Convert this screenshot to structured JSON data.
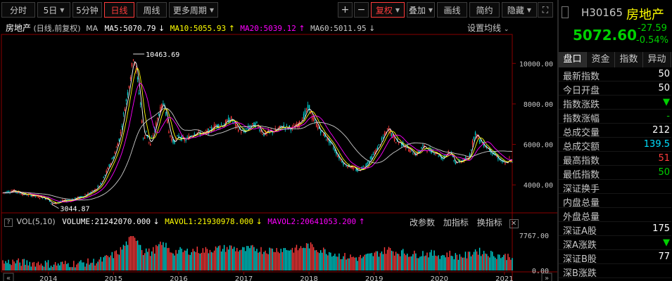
{
  "toolbar": {
    "left": [
      {
        "label": "分时",
        "dropdown": false,
        "active": false
      },
      {
        "label": "5日",
        "dropdown": true,
        "active": false
      },
      {
        "label": "5分钟",
        "dropdown": false,
        "active": false
      },
      {
        "label": "日线",
        "dropdown": false,
        "active": true
      },
      {
        "label": "周线",
        "dropdown": false,
        "active": false
      },
      {
        "label": "更多周期",
        "dropdown": true,
        "active": false
      }
    ],
    "zoom_in": "+",
    "zoom_out": "−",
    "right": [
      {
        "label": "复权",
        "dropdown": true,
        "active": true
      },
      {
        "label": "叠加",
        "dropdown": true,
        "active": false
      },
      {
        "label": "画线",
        "dropdown": false,
        "active": false
      },
      {
        "label": "简约",
        "dropdown": false,
        "active": false
      },
      {
        "label": "隐藏",
        "dropdown": true,
        "active": false
      }
    ],
    "window_icon": "⛶"
  },
  "chart_header": {
    "title": "房地产",
    "subtitle": "(日线,前复权)",
    "indicator": "MA",
    "ma5": "MA5:5070.79",
    "ma10": "MA10:5055.93",
    "ma20": "MA20:5039.12",
    "ma60": "MA60:5011.95",
    "settings": "设置均线"
  },
  "vol_header": {
    "title": "VOL(5,10)",
    "volume": "VOLUME:21242070.000",
    "mavol1": "MAVOL1:21930978.000",
    "mavol2": "MAVOL2:20641053.200",
    "btn_params": "改参数",
    "btn_add": "加指标",
    "btn_switch": "换指标"
  },
  "colors": {
    "up": "#ff3c3c",
    "down": "#00d2d2",
    "ma5": "#ffffff",
    "ma10": "#ffff00",
    "ma20": "#ff00ff",
    "ma60": "#00ff00",
    "axis": "#8a0000"
  },
  "chart_data": {
    "type": "line",
    "price_ticks": [
      "10000.00",
      "8000.00",
      "6000.00",
      "4000.00"
    ],
    "price_tick_values": [
      10000,
      8000,
      6000,
      4000
    ],
    "vol_ticks": [
      "7767.00",
      "0.00"
    ],
    "vol_tick_values": [
      7767,
      0
    ],
    "x_labels": [
      "2014",
      "2015",
      "2016",
      "2017",
      "2018",
      "2019",
      "2020",
      "2021"
    ],
    "x_label_positions": [
      2014,
      2015,
      2016,
      2017,
      2018,
      2019,
      2020,
      2021
    ],
    "annotations": [
      {
        "text": "10463.69",
        "year": 2015.3,
        "value": 10463.69
      },
      {
        "text": "3044.87",
        "year": 2014.05,
        "value": 3044.87
      }
    ],
    "close_series": [
      [
        2013.3,
        3600
      ],
      [
        2013.45,
        3720
      ],
      [
        2013.6,
        3560
      ],
      [
        2013.75,
        3480
      ],
      [
        2013.9,
        3380
      ],
      [
        2014.0,
        3320
      ],
      [
        2014.05,
        3045
      ],
      [
        2014.2,
        3180
      ],
      [
        2014.35,
        3260
      ],
      [
        2014.5,
        3400
      ],
      [
        2014.6,
        3550
      ],
      [
        2014.7,
        3700
      ],
      [
        2014.8,
        4000
      ],
      [
        2014.9,
        4700
      ],
      [
        2015.0,
        5400
      ],
      [
        2015.1,
        6400
      ],
      [
        2015.15,
        7400
      ],
      [
        2015.22,
        8600
      ],
      [
        2015.28,
        9800
      ],
      [
        2015.31,
        10463
      ],
      [
        2015.36,
        9400
      ],
      [
        2015.42,
        7800
      ],
      [
        2015.46,
        6100
      ],
      [
        2015.5,
        6700
      ],
      [
        2015.56,
        5900
      ],
      [
        2015.62,
        6600
      ],
      [
        2015.7,
        7600
      ],
      [
        2015.78,
        8100
      ],
      [
        2015.85,
        6600
      ],
      [
        2015.92,
        6100
      ],
      [
        2016.0,
        6400
      ],
      [
        2016.1,
        6200
      ],
      [
        2016.25,
        6600
      ],
      [
        2016.4,
        6500
      ],
      [
        2016.55,
        6900
      ],
      [
        2016.7,
        7000
      ],
      [
        2016.8,
        7300
      ],
      [
        2016.9,
        6800
      ],
      [
        2017.0,
        6600
      ],
      [
        2017.1,
        6900
      ],
      [
        2017.2,
        7000
      ],
      [
        2017.3,
        6500
      ],
      [
        2017.4,
        6600
      ],
      [
        2017.5,
        6700
      ],
      [
        2017.6,
        6900
      ],
      [
        2017.75,
        6800
      ],
      [
        2017.85,
        7000
      ],
      [
        2017.95,
        7600
      ],
      [
        2018.0,
        7900
      ],
      [
        2018.05,
        7300
      ],
      [
        2018.15,
        6800
      ],
      [
        2018.25,
        6400
      ],
      [
        2018.35,
        6000
      ],
      [
        2018.45,
        5400
      ],
      [
        2018.55,
        5000
      ],
      [
        2018.65,
        4900
      ],
      [
        2018.75,
        4700
      ],
      [
        2018.85,
        4900
      ],
      [
        2018.95,
        5300
      ],
      [
        2019.05,
        5800
      ],
      [
        2019.15,
        6400
      ],
      [
        2019.22,
        6800
      ],
      [
        2019.32,
        6200
      ],
      [
        2019.45,
        6000
      ],
      [
        2019.55,
        5700
      ],
      [
        2019.65,
        5500
      ],
      [
        2019.75,
        5900
      ],
      [
        2019.85,
        5700
      ],
      [
        2019.95,
        5600
      ],
      [
        2020.05,
        5300
      ],
      [
        2020.15,
        5700
      ],
      [
        2020.25,
        5100
      ],
      [
        2020.35,
        5200
      ],
      [
        2020.45,
        5300
      ],
      [
        2020.55,
        6600
      ],
      [
        2020.62,
        6200
      ],
      [
        2020.72,
        5900
      ],
      [
        2020.85,
        5500
      ],
      [
        2020.95,
        5200
      ],
      [
        2021.02,
        5000
      ],
      [
        2021.08,
        5300
      ],
      [
        2021.12,
        5070
      ]
    ]
  },
  "quote": {
    "code": "H30165",
    "name": "房地产",
    "price": "5072.60",
    "change": "-27.59",
    "change_pct": "-0.54%",
    "tabs": [
      "盘口",
      "资金",
      "指数",
      "异动"
    ],
    "rows": [
      {
        "label": "最新指数",
        "value": "50",
        "color": "#ffffff"
      },
      {
        "label": "今日开盘",
        "value": "50",
        "color": "#ffffff"
      },
      {
        "label": "指数涨跌",
        "value": "▼",
        "color": "#00d000"
      },
      {
        "label": "指数涨幅",
        "value": "-",
        "color": "#00d000"
      },
      {
        "label": "总成交量",
        "value": "212",
        "color": "#ffffff"
      },
      {
        "label": "总成交额",
        "value": "139.5",
        "color": "#00e0ff"
      },
      {
        "label": "最高指数",
        "value": "51",
        "color": "#ff3c3c"
      },
      {
        "label": "最低指数",
        "value": "50",
        "color": "#00d000"
      },
      {
        "label": "深证换手",
        "value": "",
        "color": "#ffffff"
      },
      {
        "label": "内盘总量",
        "value": "",
        "color": "#ffffff"
      },
      {
        "label": "外盘总量",
        "value": "",
        "color": "#ffffff"
      },
      {
        "label": "深证A股",
        "value": "175",
        "color": "#ffffff"
      },
      {
        "label": "深A涨跌",
        "value": "▼",
        "color": "#00d000"
      },
      {
        "label": "深证B股",
        "value": "77",
        "color": "#ffffff"
      },
      {
        "label": "深B涨跌",
        "value": "",
        "color": "#ffffff"
      }
    ]
  }
}
